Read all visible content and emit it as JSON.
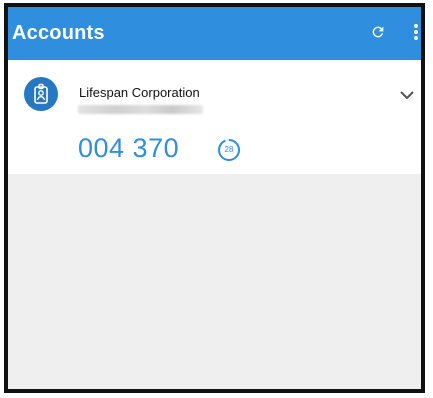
{
  "appbar": {
    "title": "Accounts",
    "refresh_icon": "refresh-icon",
    "menu_icon": "more-vert-icon",
    "background_color": "#2f8ede"
  },
  "accounts": [
    {
      "icon": "id-badge-icon",
      "name": "Lifespan Corporation",
      "code": "004 370",
      "seconds_remaining": "28",
      "accent_color": "#2f8ede"
    }
  ]
}
